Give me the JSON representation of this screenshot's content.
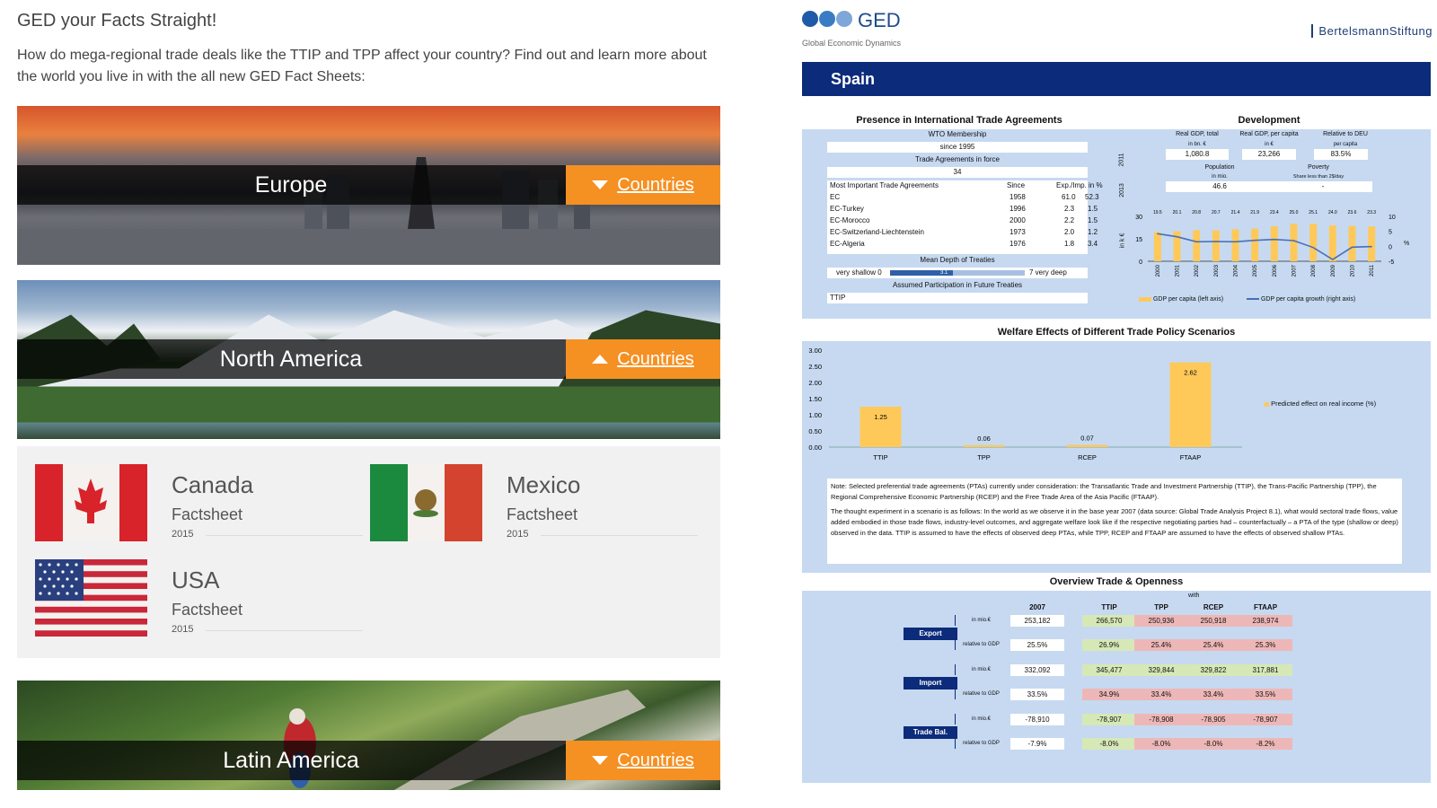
{
  "left": {
    "title": "GED your Facts Straight!",
    "intro": "How do mega-regional trade deals like the TTIP and TPP affect your country? Find out and learn more about the world you live in with the all new GED Fact Sheets:",
    "regions": [
      {
        "label": "Europe",
        "button": "Countries",
        "expanded": false
      },
      {
        "label": "North America",
        "button": "Countries",
        "expanded": true
      },
      {
        "label": "Latin America",
        "button": "Countries",
        "expanded": false
      }
    ],
    "countries": [
      {
        "name": "Canada",
        "link": "Factsheet",
        "year": "2015"
      },
      {
        "name": "Mexico",
        "link": "Factsheet",
        "year": "2015"
      },
      {
        "name": "USA",
        "link": "Factsheet",
        "year": "2015"
      }
    ]
  },
  "right": {
    "logo_text": "GED",
    "logo_sub": "Global Economic Dynamics",
    "stiftung": "BertelsmannStiftung",
    "country": "Spain",
    "presence": {
      "title": "Presence in International Trade Agreements",
      "wto_label": "WTO Membership",
      "wto_value": "since 1995",
      "force_label": "Trade Agreements in force",
      "force_value": "34",
      "col_agreements": "Most Important Trade Agreements",
      "col_since": "Since",
      "col_exp": "Exp./Imp. in %",
      "agreements": [
        {
          "name": "EC",
          "since": "1958",
          "exp": "61.0",
          "imp": "52.3"
        },
        {
          "name": "EC-Turkey",
          "since": "1996",
          "exp": "2.3",
          "imp": "1.5"
        },
        {
          "name": "EC-Morocco",
          "since": "2000",
          "exp": "2.2",
          "imp": "1.5"
        },
        {
          "name": "EC-Switzerland-Liechtenstein",
          "since": "1973",
          "exp": "2.0",
          "imp": "1.2"
        },
        {
          "name": "EC-Algeria",
          "since": "1976",
          "exp": "1.8",
          "imp": "3.4"
        }
      ],
      "depth_label": "Mean Depth of Treaties",
      "depth_low": "very shallow 0",
      "depth_high": "7 very deep",
      "depth_value": "3.1",
      "future_label": "Assumed Participation in Future Treaties",
      "future_value": "TTIP"
    },
    "development": {
      "title": "Development",
      "h_gdp_total": "Real GDP, total",
      "h_gdp_pc": "Real GDP, per capita",
      "h_rel": "Relative to DEU",
      "u_bn": "in bn. €",
      "u_eur": "in €",
      "u_pc": "per capita",
      "year1": "2011",
      "gdp_total": "1,080.8",
      "gdp_pc": "23,266",
      "rel_deu": "83.5%",
      "h_pop": "Population",
      "h_pov": "Poverty",
      "u_mio": "in mio.",
      "u_share": "Share less than 2$/day",
      "year2": "2013",
      "population": "46.6",
      "poverty": "-",
      "axis_left": "in k €",
      "axis_right": "%",
      "legend_bar": "GDP per capita (left axis)",
      "legend_line": "GDP per capita growth (right axis)"
    },
    "welfare": {
      "title": "Welfare Effects of Different Trade Policy Scenarios",
      "legend": "Predicted effect on real income (%)",
      "note1": "Note: Selected preferential trade agreements (PTAs) currently under consideration: the Transatlantic Trade and Investment Partnership (TTIP), the Trans-Pacific Partnership (TPP), the Regional Comprehensive Economic Partnership (RCEP) and the Free Trade Area of the Asia Pacific (FTAAP).",
      "note2": "The thought experiment in a scenario is as follows: In the world as we observe it in the base year 2007 (data source: Global Trade Analysis Project 8.1), what would sectoral trade flows, value added embodied in those trade flows, industry-level outcomes, and aggregate welfare look like if the respective negotiating parties had – counterfactually – a PTA of the type (shallow or deep) observed in the data. TTIP is assumed to have the effects of observed deep PTAs, while TPP, RCEP and FTAAP are assumed to have the effects of observed shallow PTAs."
    },
    "overview": {
      "title": "Overview Trade & Openness",
      "with": "with",
      "cols": [
        "2007",
        "TTIP",
        "TPP",
        "RCEP",
        "FTAAP"
      ],
      "rows": [
        {
          "label": "Export",
          "abs_unit": "in mio.€",
          "rel_unit": "relative to GDP",
          "abs": [
            "253,182",
            "266,570",
            "250,936",
            "250,918",
            "238,974"
          ],
          "rel": [
            "25.5%",
            "26.9%",
            "25.4%",
            "25.4%",
            "25.3%"
          ]
        },
        {
          "label": "Import",
          "abs_unit": "in mio.€",
          "rel_unit": "relative to GDP",
          "abs": [
            "332,092",
            "345,477",
            "329,844",
            "329,822",
            "317,881"
          ],
          "rel": [
            "33.5%",
            "34.9%",
            "33.4%",
            "33.4%",
            "33.5%"
          ]
        },
        {
          "label": "Trade Bal.",
          "abs_unit": "in mio.€",
          "rel_unit": "relative to GDP",
          "abs": [
            "-78,910",
            "-78,907",
            "-78,908",
            "-78,905",
            "-78,907"
          ],
          "rel": [
            "-7.9%",
            "-8.0%",
            "-8.0%",
            "-8.0%",
            "-8.2%"
          ]
        }
      ],
      "row_colors": [
        [
          "white",
          "green",
          "red",
          "red",
          "red"
        ],
        [
          "white",
          "green",
          "red",
          "red",
          "red"
        ],
        [
          "white",
          "green",
          "green",
          "green",
          "green"
        ],
        [
          "white",
          "red",
          "red",
          "red",
          "red"
        ],
        [
          "white",
          "green",
          "red",
          "red",
          "red"
        ],
        [
          "white",
          "green",
          "red",
          "red",
          "red"
        ]
      ]
    }
  },
  "chart_data": [
    {
      "type": "bar",
      "title": "Welfare Effects of Different Trade Policy Scenarios",
      "categories": [
        "TTIP",
        "TPP",
        "RCEP",
        "FTAAP"
      ],
      "values": [
        1.25,
        0.06,
        0.07,
        2.62
      ],
      "labels": [
        "1.25",
        "0.06",
        "0.07",
        "2.62"
      ],
      "ylim": [
        0,
        3
      ],
      "yticks": [
        "0.00",
        "0.50",
        "1.00",
        "1.50",
        "2.00",
        "2.50",
        "3.00"
      ],
      "legend": "Predicted effect on real income (%)",
      "color": "#ffc95a"
    },
    {
      "type": "bar",
      "categories": [
        "2000",
        "2001",
        "2002",
        "2003",
        "2004",
        "2005",
        "2006",
        "2007",
        "2008",
        "2009",
        "2010",
        "2011"
      ],
      "values": [
        19.5,
        20.1,
        20.8,
        20.7,
        21.4,
        21.9,
        23.4,
        25.0,
        25.1,
        24.0,
        23.6,
        23.3
      ],
      "labels": [
        "19.5",
        "20.1",
        "20.8",
        "20.7",
        "21.4",
        "21.9",
        "23.4",
        "25.0",
        "25.1",
        "24.0",
        "23.6",
        "23.3"
      ],
      "line_values": [
        4.2,
        3.2,
        1.5,
        1.6,
        1.5,
        2.0,
        2.3,
        1.9,
        -0.4,
        -4.4,
        -0.3,
        -0.1
      ],
      "ylim": [
        0,
        30
      ],
      "y2lim": [
        -5,
        10
      ],
      "yticks": [
        "0",
        "15",
        "30"
      ],
      "y2ticks": [
        "-5",
        "0",
        "5",
        "10"
      ],
      "legend": [
        "GDP per capita (left axis)",
        "GDP per capita growth (right axis)"
      ],
      "bar_color": "#ffc95a",
      "line_color": "#4a6fb5"
    }
  ]
}
